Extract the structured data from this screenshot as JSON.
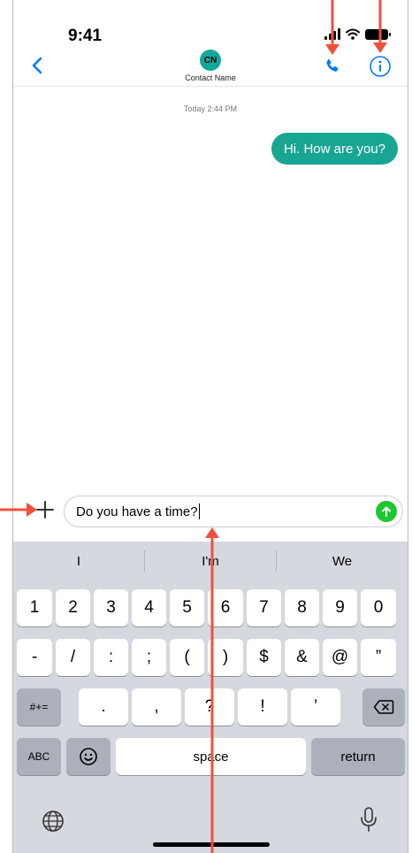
{
  "status_bar": {
    "time": "9:41"
  },
  "header": {
    "avatar_initials": "CN",
    "contact_name": "Contact Name"
  },
  "chat": {
    "timestamp": "Today 2:44 PM",
    "messages": [
      {
        "text": "Hi. How are you?",
        "direction": "outgoing"
      }
    ]
  },
  "composer": {
    "value": "Do you have a time?"
  },
  "keyboard": {
    "suggestions": [
      "I",
      "I'm",
      "We"
    ],
    "row1": [
      "1",
      "2",
      "3",
      "4",
      "5",
      "6",
      "7",
      "8",
      "9",
      "0"
    ],
    "row2": [
      "-",
      "/",
      ":",
      ";",
      "(",
      ")",
      "$",
      "&",
      "@",
      "”"
    ],
    "row3": {
      "shift": "#+=",
      "keys": [
        ".",
        ",",
        "?",
        "!",
        "’"
      ]
    },
    "row4": {
      "abc": "ABC",
      "space": "space",
      "return": "return"
    }
  },
  "colors": {
    "accent": "#007aff",
    "bubble": "#18a692",
    "send": "#1ec72f",
    "annotation": "#f0503c",
    "keyboard_bg": "#d5d8de"
  },
  "icons": [
    "chevron-left-icon",
    "phone-icon",
    "info-icon",
    "plus-icon",
    "send-arrow-icon",
    "delete-icon",
    "emoji-icon",
    "globe-icon",
    "microphone-icon"
  ]
}
